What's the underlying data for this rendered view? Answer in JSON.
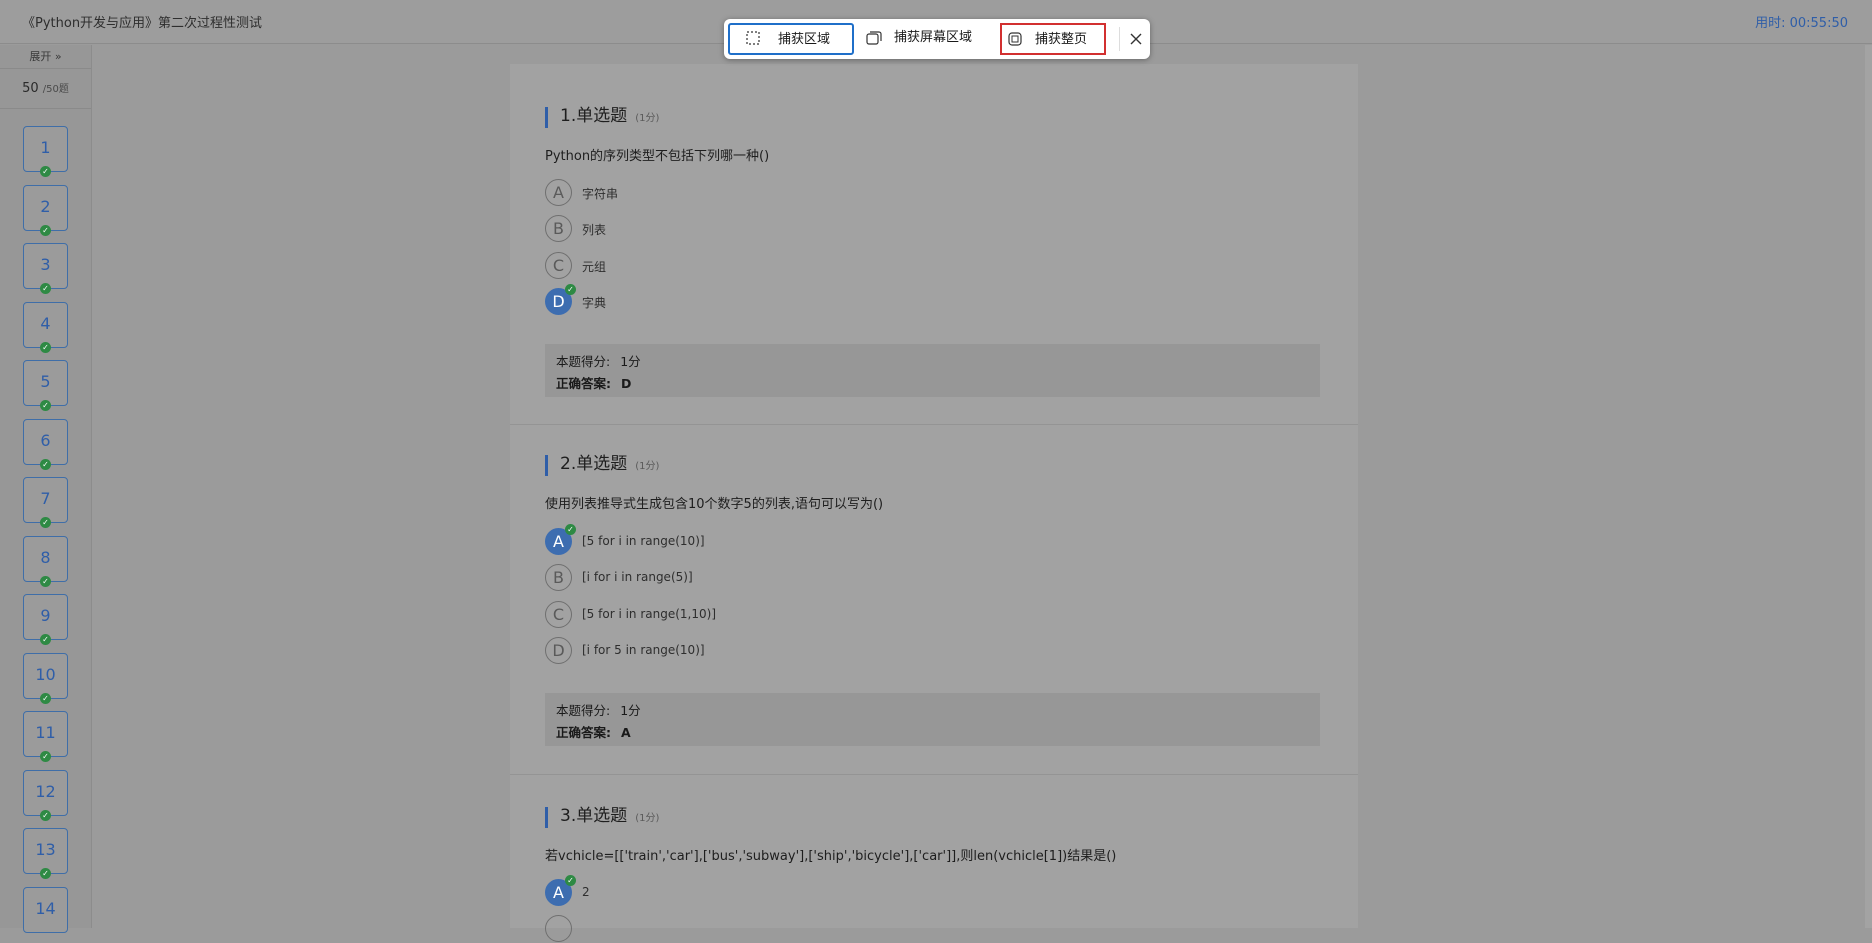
{
  "header": {
    "title": "《Python开发与应用》第二次过程性测试",
    "timer": "用时: 00:55:50"
  },
  "sidebar": {
    "expand_label": "展开 »",
    "count": "50",
    "count_total": "/50题",
    "questions": [
      "1",
      "2",
      "3",
      "4",
      "5",
      "6",
      "7",
      "8",
      "9",
      "10",
      "11",
      "12",
      "13",
      "14"
    ]
  },
  "capture_toolbar": {
    "region": "捕获区域",
    "screen_region": "捕获屏幕区域",
    "full_page": "捕获整页",
    "close_icon": "close-icon"
  },
  "questions": [
    {
      "head": "1.单选题",
      "score": "(1分)",
      "text": "Python的序列类型不包括下列哪一种()",
      "options": [
        {
          "letter": "A",
          "text": "字符串"
        },
        {
          "letter": "B",
          "text": "列表"
        },
        {
          "letter": "C",
          "text": "元组"
        },
        {
          "letter": "D",
          "text": "字典"
        }
      ],
      "score_label": "本题得分:",
      "score_value": "1分",
      "answer_label": "正确答案:",
      "answer_value": "D"
    },
    {
      "head": "2.单选题",
      "score": "(1分)",
      "text": "使用列表推导式生成包含10个数字5的列表,语句可以写为()",
      "options": [
        {
          "letter": "A",
          "text": "[5  for  i  in  range(10)]"
        },
        {
          "letter": "B",
          "text": "[i for i in range(5)]"
        },
        {
          "letter": "C",
          "text": "[5 for i in range(1,10)]"
        },
        {
          "letter": "D",
          "text": "[i for 5 in range(10)]"
        }
      ],
      "score_label": "本题得分:",
      "score_value": "1分",
      "answer_label": "正确答案:",
      "answer_value": "A"
    },
    {
      "head": "3.单选题",
      "score": "(1分)",
      "text": "若vchicle=[['train','car'],['bus','subway'],['ship','bicycle'],['car']],则len(vchicle[1])结果是()",
      "options": [
        {
          "letter": "A",
          "text": "2"
        }
      ]
    }
  ]
}
